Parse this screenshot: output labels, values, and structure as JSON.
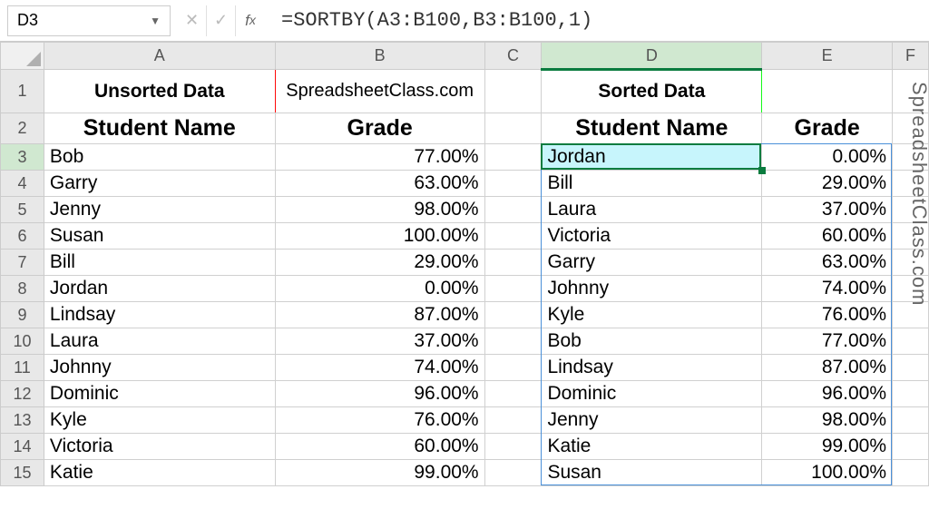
{
  "name_box": "D3",
  "formula": "=SORTBY(A3:B100,B3:B100,1)",
  "columns": [
    "A",
    "B",
    "C",
    "D",
    "E",
    "F"
  ],
  "selected_col": "D",
  "selected_row": 3,
  "header1": {
    "unsorted_title": "Unsorted Data",
    "unsorted_sub": "SpreadsheetClass.com",
    "sorted_title": "Sorted Data"
  },
  "header2": {
    "a": "Student Name",
    "b": "Grade",
    "d": "Student Name",
    "e": "Grade"
  },
  "unsorted": [
    {
      "name": "Bob",
      "grade": "77.00%"
    },
    {
      "name": "Garry",
      "grade": "63.00%"
    },
    {
      "name": "Jenny",
      "grade": "98.00%"
    },
    {
      "name": "Susan",
      "grade": "100.00%"
    },
    {
      "name": "Bill",
      "grade": "29.00%"
    },
    {
      "name": "Jordan",
      "grade": "0.00%"
    },
    {
      "name": "Lindsay",
      "grade": "87.00%"
    },
    {
      "name": "Laura",
      "grade": "37.00%"
    },
    {
      "name": "Johnny",
      "grade": "74.00%"
    },
    {
      "name": "Dominic",
      "grade": "96.00%"
    },
    {
      "name": "Kyle",
      "grade": "76.00%"
    },
    {
      "name": "Victoria",
      "grade": "60.00%"
    },
    {
      "name": "Katie",
      "grade": "99.00%"
    }
  ],
  "sorted": [
    {
      "name": "Jordan",
      "grade": "0.00%"
    },
    {
      "name": "Bill",
      "grade": "29.00%"
    },
    {
      "name": "Laura",
      "grade": "37.00%"
    },
    {
      "name": "Victoria",
      "grade": "60.00%"
    },
    {
      "name": "Garry",
      "grade": "63.00%"
    },
    {
      "name": "Johnny",
      "grade": "74.00%"
    },
    {
      "name": "Kyle",
      "grade": "76.00%"
    },
    {
      "name": "Bob",
      "grade": "77.00%"
    },
    {
      "name": "Lindsay",
      "grade": "87.00%"
    },
    {
      "name": "Dominic",
      "grade": "96.00%"
    },
    {
      "name": "Jenny",
      "grade": "98.00%"
    },
    {
      "name": "Katie",
      "grade": "99.00%"
    },
    {
      "name": "Susan",
      "grade": "100.00%"
    }
  ],
  "watermark": "SpreadsheetClass.com"
}
